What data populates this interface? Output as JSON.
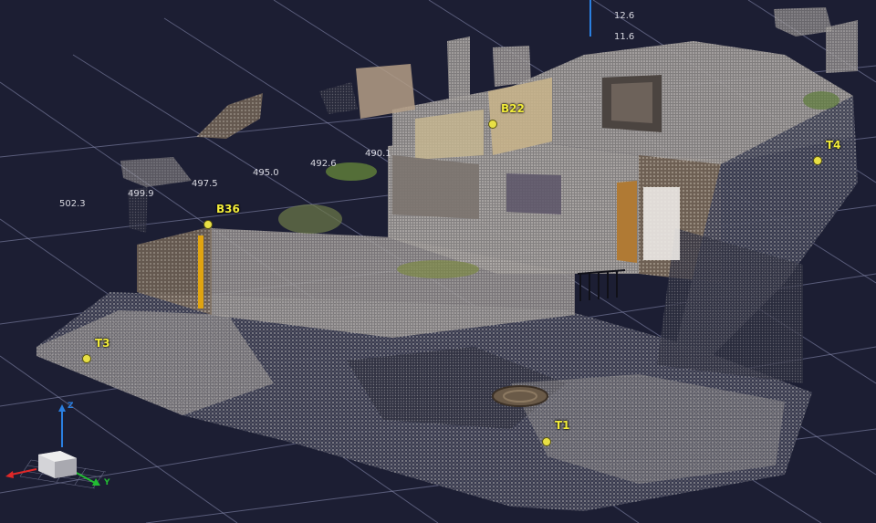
{
  "viewer": {
    "background": "#1c1e33",
    "grid_color": "#8c90b4",
    "marker_color": "#e8e045",
    "label_color": "#f2ec3a"
  },
  "grid_labels": [
    "12.6",
    "11.6",
    "502.3",
    "499.9",
    "497.5",
    "495.0",
    "492.6",
    "490.1"
  ],
  "markers": [
    {
      "label": "B22"
    },
    {
      "label": "T4"
    },
    {
      "label": "B36"
    },
    {
      "label": "T3"
    },
    {
      "label": "T1"
    }
  ],
  "axes": {
    "z_label": "Z",
    "y_label": "Y",
    "x_color": "#e02828",
    "y_color": "#22bb33",
    "z_color": "#2a7fe0"
  }
}
